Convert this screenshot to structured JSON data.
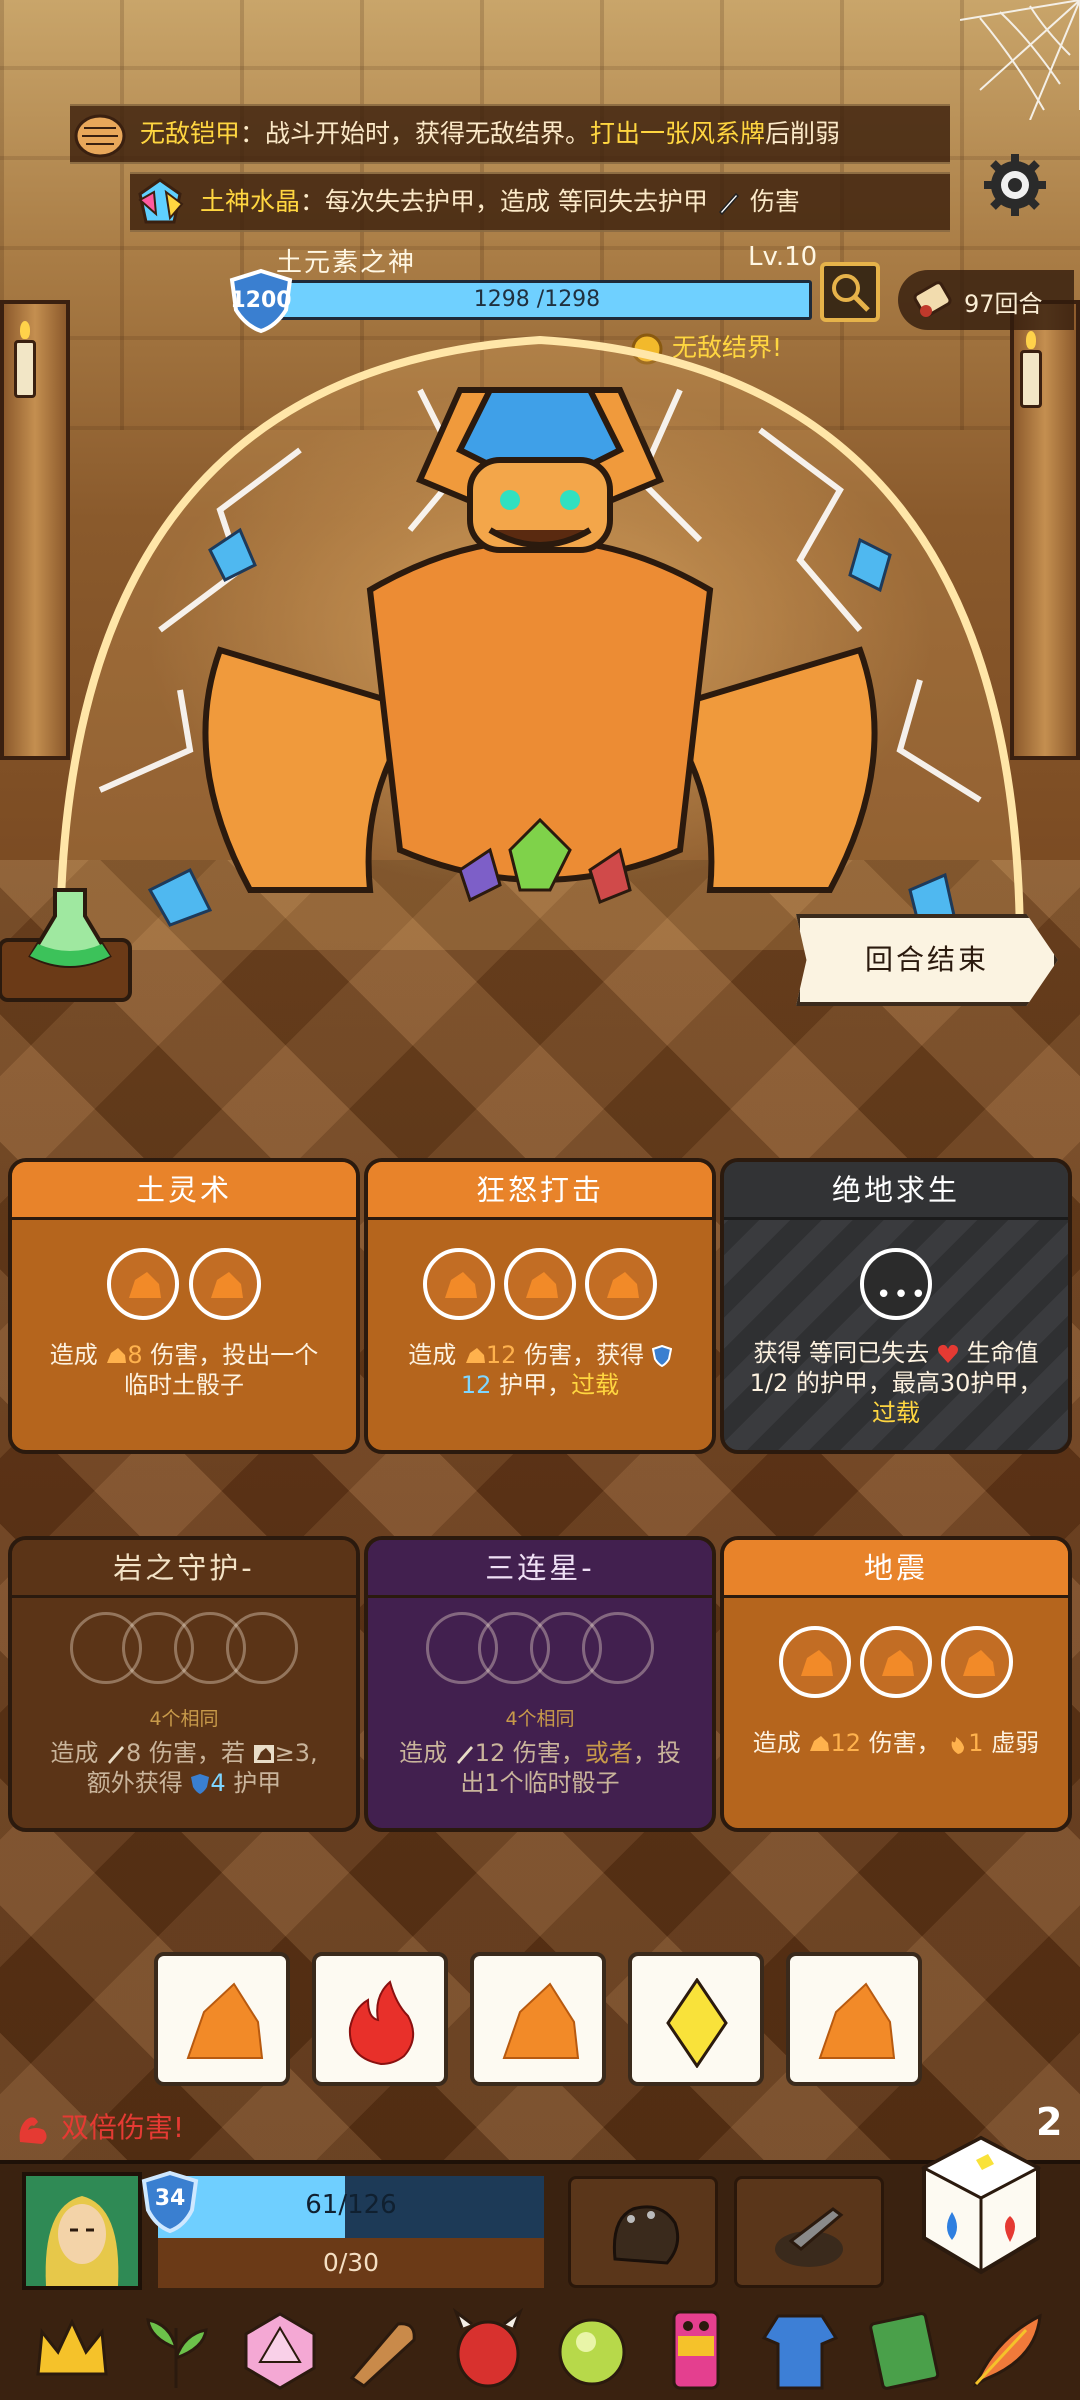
{
  "relics_banner": {
    "armor_name": "无敌铠甲",
    "armor_text_1": "：战斗开始时，获得无敌结界。",
    "armor_text_hl": "打出一张风系牌",
    "armor_text_2": "后削弱",
    "crystal_name": "土神水晶",
    "crystal_text_1": "：每次失去护甲，造成 等同失去护甲",
    "crystal_text_2": "伤害"
  },
  "boss": {
    "name": "土元素之神",
    "level": "Lv.10",
    "shield": "1200",
    "hp_text": "1298 /1298",
    "hp_fraction": 1.0,
    "status": "无敌结界!"
  },
  "turn_counter": "97回合",
  "end_turn_label": "回合结束",
  "cards": {
    "c1": {
      "title": "土灵术",
      "dmg": "8",
      "desc_a": "造成",
      "desc_b": "伤害，投出一个",
      "desc_c": "临时土骰子"
    },
    "c2": {
      "title": "狂怒打击",
      "dmg": "12",
      "armor": "12",
      "desc_a": "造成",
      "desc_b": "伤害，获得",
      "desc_c": "护甲，",
      "desc_hl": "过载"
    },
    "c3": {
      "title": "绝地求生",
      "dots": "•••",
      "desc_a": "获得 等同已失去",
      "desc_b": "生命值",
      "desc_c": "1/2 的护甲，最高30护甲，",
      "desc_hl": "过载"
    },
    "c4": {
      "title": "岩之守护-",
      "same": "4个相同",
      "dmg": "8",
      "desc_a": "造成",
      "desc_b": "伤害，若",
      "desc_c": "≥3,",
      "desc_d": "额外获得",
      "armor": "4",
      "desc_e": "护甲"
    },
    "c5": {
      "title": "三连星-",
      "same": "4个相同",
      "dmg": "12",
      "desc_a": "造成",
      "desc_b": "伤害，",
      "desc_hl": "或者",
      "desc_c": "，投",
      "desc_d": "出1个临时骰子"
    },
    "c6": {
      "title": "地震",
      "dmg": "12",
      "weak": "1",
      "desc_a": "造成",
      "desc_b": "伤害，",
      "desc_c": "虚弱"
    }
  },
  "dice": [
    "earth",
    "fire",
    "earth",
    "light",
    "earth"
  ],
  "double_damage": "双倍伤害!",
  "reroll_count": "2",
  "player": {
    "shield": "34",
    "hp_text": "61/126",
    "hp_fraction": 0.484,
    "energy_text": "0/30"
  },
  "colors": {
    "accent": "#e8832a",
    "highlight": "#ffd640",
    "hp_blue": "#6fcfff",
    "danger": "#e53a33"
  }
}
